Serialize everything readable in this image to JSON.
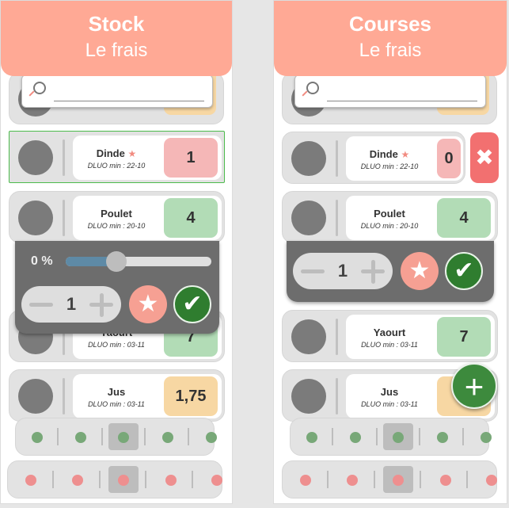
{
  "left_panel": {
    "title": "Stock",
    "subtitle": "Le frais",
    "items": [
      {
        "name": "Dinde",
        "star": "★",
        "dluo": "DLUO min : 22-10",
        "qty": "1"
      },
      {
        "name": "Poulet",
        "dluo": "DLUO min : 20-10",
        "qty": "4"
      },
      {
        "name": "Yaourt",
        "dluo": "DLUO min : 03-11",
        "qty": "7"
      },
      {
        "name": "Jus",
        "dluo": "DLUO min : 03-11",
        "qty": "1,75"
      }
    ],
    "editor": {
      "percent": "0 %",
      "slider_fraction": 0.35,
      "step_value": "1"
    }
  },
  "right_panel": {
    "title": "Courses",
    "subtitle": "Le frais",
    "items": [
      {
        "name": "Dinde",
        "star": "★",
        "dluo": "DLUO min : 22-10",
        "qty": "0"
      },
      {
        "name": "Poulet",
        "dluo": "DLUO min : 20-10",
        "qty": "4"
      },
      {
        "name": "Yaourt",
        "dluo": "DLUO min : 03-11",
        "qty": "7"
      },
      {
        "name": "Jus",
        "dluo": "DLUO min : 03-11",
        "qty": "1,"
      }
    ],
    "editor": {
      "step_value": "1"
    }
  },
  "icons": {
    "search": "search-icon",
    "star": "star-icon",
    "check": "check-icon",
    "close": "close-icon",
    "add": "plus-icon"
  },
  "colors": {
    "header": "#ffa995",
    "qty_pink": "#f5b7b7",
    "qty_green": "#b2dcb6",
    "qty_orange": "#f7d7a3",
    "confirm": "#2f7d2f",
    "delete": "#f27070"
  }
}
